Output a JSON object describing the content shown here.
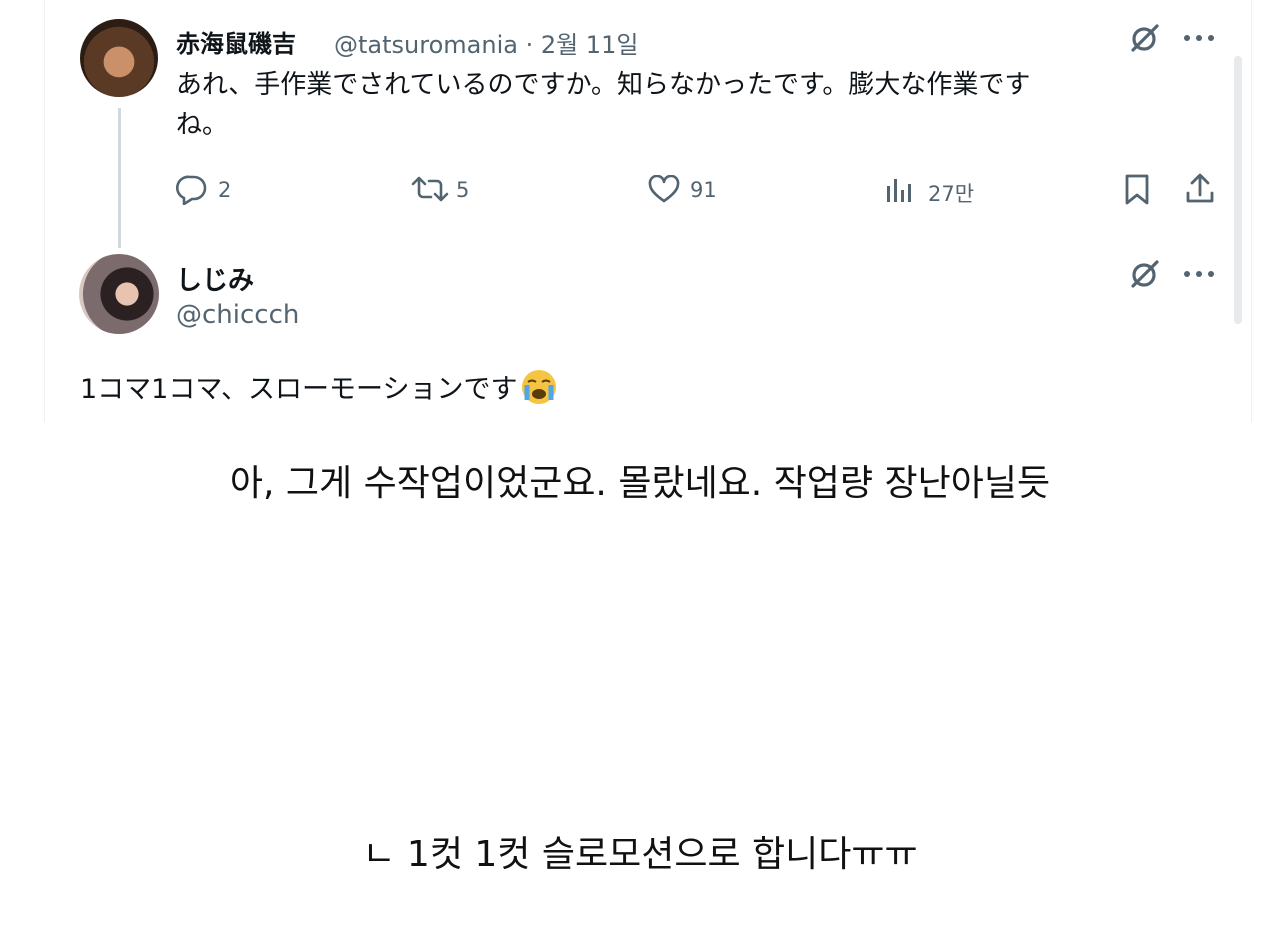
{
  "tweet1": {
    "display_name": "赤海鼠磯吉",
    "handle_date": "@tatsuromania · 2월 11일",
    "text_line1": "あれ、手作業でされているのですか。知らなかったです。膨大な作業です",
    "text_line2": "ね。",
    "replies": "2",
    "retweets": "5",
    "likes": "91",
    "views": "27만"
  },
  "tweet2": {
    "display_name": "しじみ",
    "handle": "@chiccch",
    "text": "1コマ1コマ、スローモーションです",
    "emoji": "crying-face-emoji"
  },
  "captions": {
    "caption1": "아, 그게 수작업이었군요. 몰랐네요. 작업량 장난아닐듯",
    "caption2": "ㄴ 1컷 1컷 슬로모션으로 합니다ㅠㅠ"
  },
  "colors": {
    "text": "#0f1419",
    "muted": "#536471",
    "thread_line": "#cfd9de"
  },
  "icons": [
    "grok-icon",
    "more-icon",
    "reply-icon",
    "retweet-icon",
    "like-icon",
    "views-icon",
    "bookmark-icon",
    "share-icon"
  ]
}
